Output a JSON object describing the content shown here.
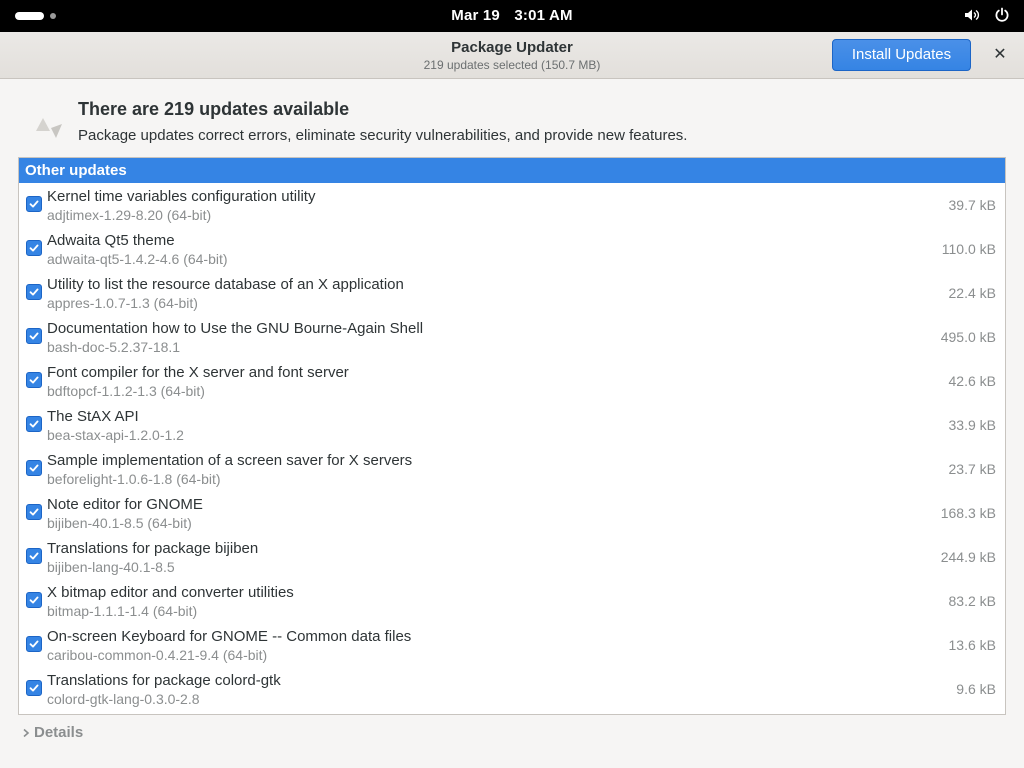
{
  "topbar": {
    "date": "Mar 19",
    "time": "3:01 AM",
    "icons": [
      "activities-indicator",
      "volume-icon",
      "power-icon"
    ]
  },
  "window": {
    "title": "Package Updater",
    "subtitle": "219 updates selected (150.7 MB)",
    "install_label": "Install Updates",
    "close_label": "✕"
  },
  "intro": {
    "title": "There are 219 updates available",
    "description": "Package updates correct errors, eliminate security vulnerabilities, and provide new features.",
    "icon": "update-icon"
  },
  "list": {
    "header": "Other updates",
    "items": [
      {
        "name": "Kernel time variables configuration utility",
        "package": "adjtimex-1.29-8.20 (64-bit)",
        "size": "39.7 kB",
        "checked": true
      },
      {
        "name": "Adwaita Qt5 theme",
        "package": "adwaita-qt5-1.4.2-4.6 (64-bit)",
        "size": "110.0 kB",
        "checked": true
      },
      {
        "name": "Utility to list the resource database of an X application",
        "package": "appres-1.0.7-1.3 (64-bit)",
        "size": "22.4 kB",
        "checked": true
      },
      {
        "name": "Documentation how to Use the GNU Bourne-Again Shell",
        "package": "bash-doc-5.2.37-18.1",
        "size": "495.0 kB",
        "checked": true
      },
      {
        "name": "Font compiler for the X server and font server",
        "package": "bdftopcf-1.1.2-1.3 (64-bit)",
        "size": "42.6 kB",
        "checked": true
      },
      {
        "name": "The StAX API",
        "package": "bea-stax-api-1.2.0-1.2",
        "size": "33.9 kB",
        "checked": true
      },
      {
        "name": "Sample implementation of a screen saver for X servers",
        "package": "beforelight-1.0.6-1.8 (64-bit)",
        "size": "23.7 kB",
        "checked": true
      },
      {
        "name": "Note editor for GNOME",
        "package": "bijiben-40.1-8.5 (64-bit)",
        "size": "168.3 kB",
        "checked": true
      },
      {
        "name": "Translations for package bijiben",
        "package": "bijiben-lang-40.1-8.5",
        "size": "244.9 kB",
        "checked": true
      },
      {
        "name": "X bitmap editor and converter utilities",
        "package": "bitmap-1.1.1-1.4 (64-bit)",
        "size": "83.2 kB",
        "checked": true
      },
      {
        "name": "On-screen Keyboard for GNOME -- Common data files",
        "package": "caribou-common-0.4.21-9.4 (64-bit)",
        "size": "13.6 kB",
        "checked": true
      },
      {
        "name": "Translations for package colord-gtk",
        "package": "colord-gtk-lang-0.3.0-2.8",
        "size": "9.6 kB",
        "checked": true
      }
    ]
  },
  "details": {
    "label": "Details",
    "icon": "chevron-right-icon"
  },
  "colors": {
    "accent": "#3584e4",
    "topbar": "#000000",
    "window_bg": "#f6f5f4"
  }
}
